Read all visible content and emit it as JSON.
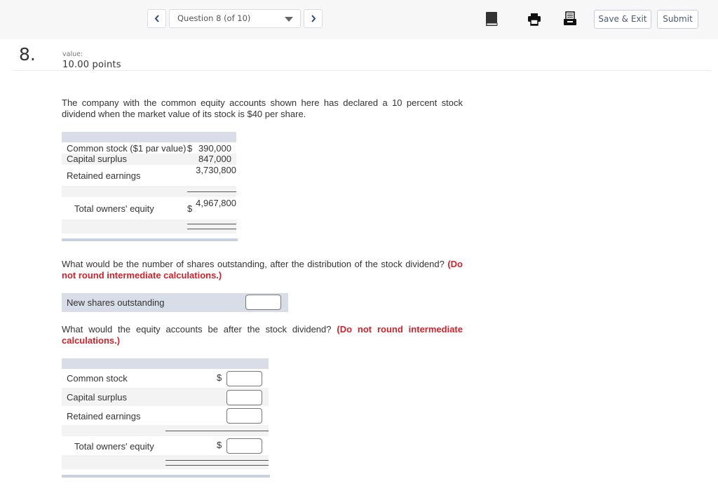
{
  "topbar": {
    "prev_label": "previous question",
    "question_select": "Question 8 (of 10)",
    "next_label": "next question",
    "icons": [
      "ebook-icon",
      "print-icon",
      "calculator-icon"
    ],
    "save_exit": "Save & Exit",
    "submit": "Submit"
  },
  "question": {
    "number": "8.",
    "value_label": "value:",
    "points": "10.00 points",
    "intro": "The company with the common equity accounts shown here has declared a 10 percent stock dividend when the market value of its stock is $40 per share."
  },
  "given_table": {
    "rows": [
      {
        "label": "Common stock ($1 par value)",
        "currency": "$",
        "value": "390,000"
      },
      {
        "label": "Capital surplus",
        "currency": "",
        "value": "847,000"
      },
      {
        "label": "Retained earnings",
        "currency": "",
        "value": "3,730,800"
      }
    ],
    "total": {
      "label": "Total owners' equity",
      "currency": "$",
      "value": "4,967,800"
    }
  },
  "part1": {
    "prompt": "What would be the number of shares outstanding, after the distribution of the stock dividend?",
    "warning": "(Do not round intermediate calculations.)",
    "field_label": "New shares outstanding",
    "field_value": ""
  },
  "part2": {
    "prompt": "What would the equity accounts be after the stock dividend?",
    "warning": "(Do not round intermediate calculations.)",
    "rows": [
      {
        "label": "Common stock",
        "currency": "$",
        "value": ""
      },
      {
        "label": "Capital surplus",
        "currency": "",
        "value": ""
      },
      {
        "label": "Retained earnings",
        "currency": "",
        "value": ""
      }
    ],
    "total": {
      "label": "Total owners' equity",
      "currency": "$",
      "value": ""
    }
  }
}
